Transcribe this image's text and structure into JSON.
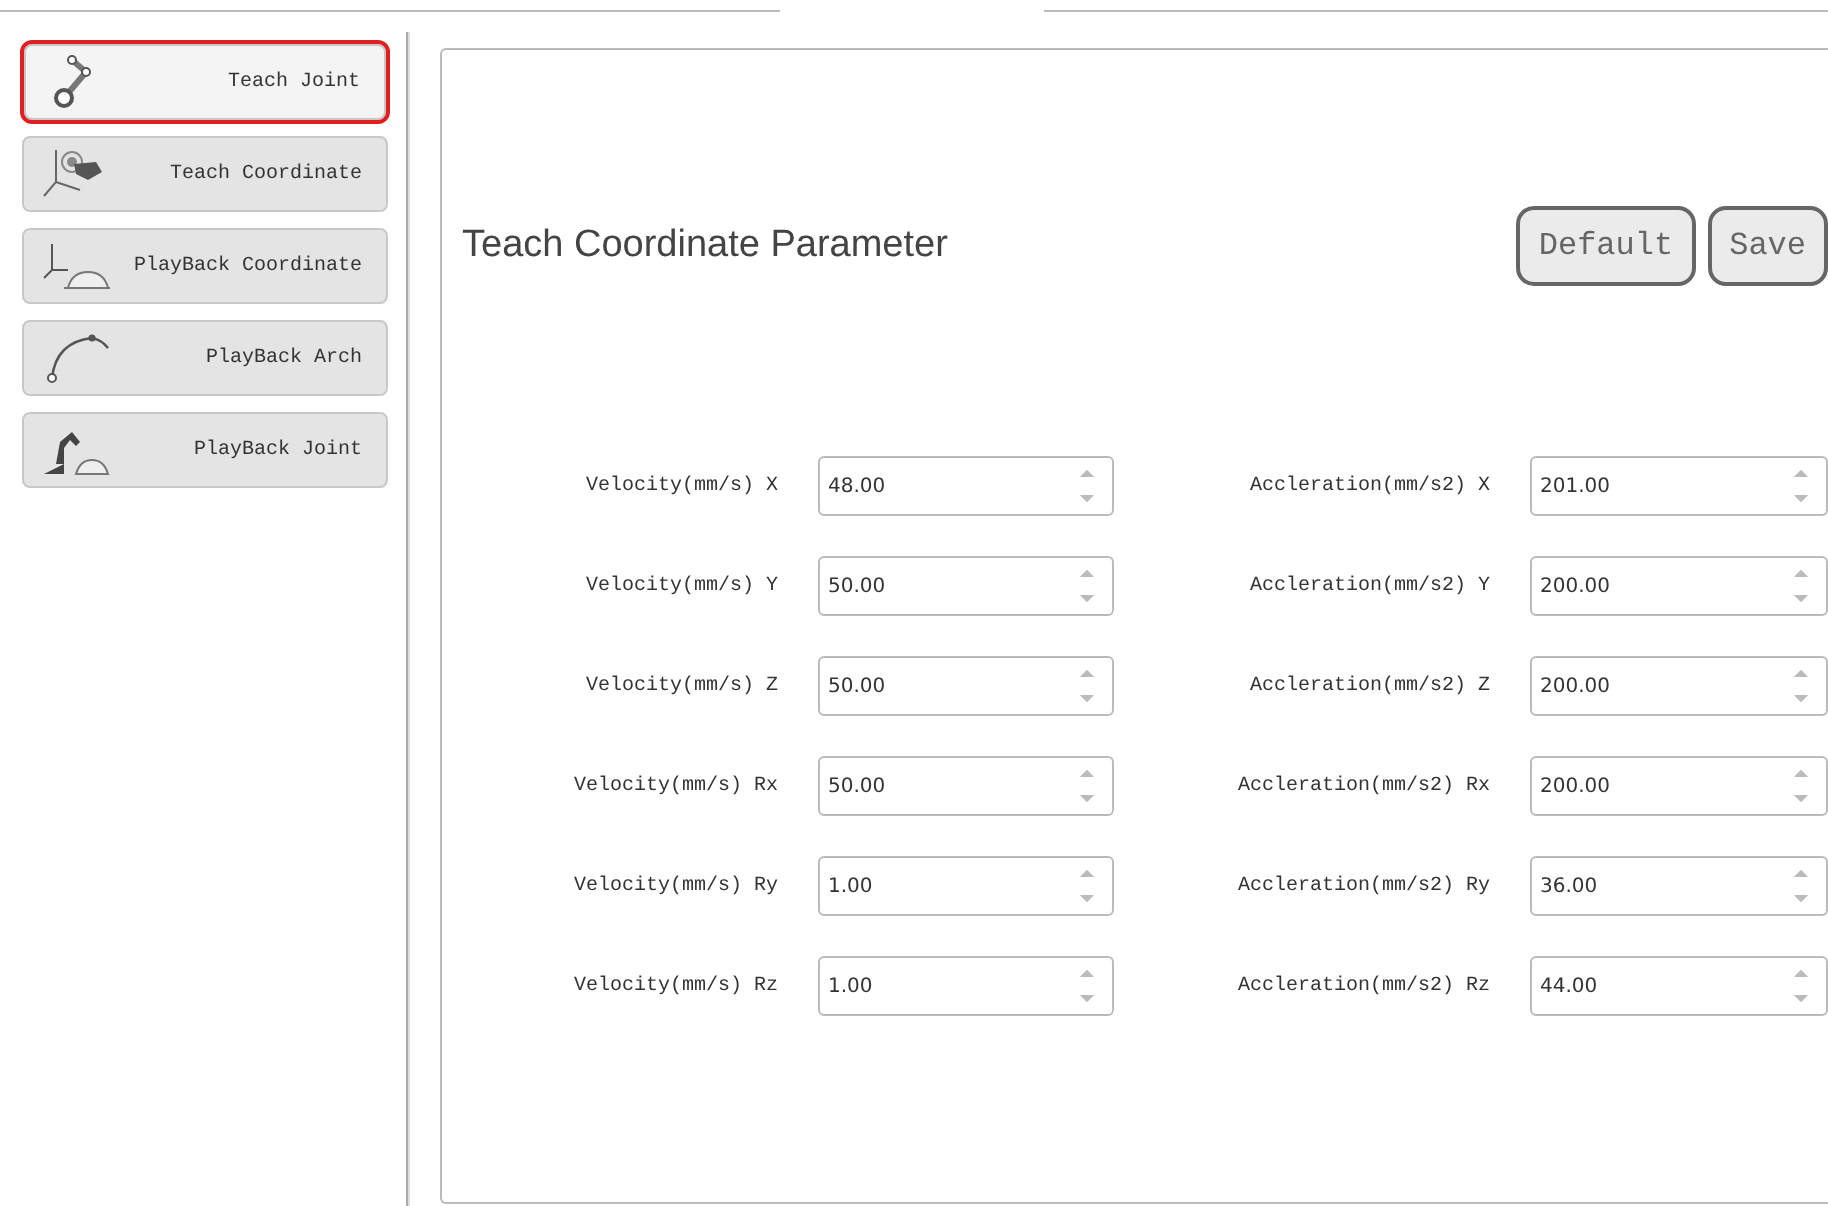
{
  "sidebar": {
    "items": [
      {
        "label": "Teach Joint",
        "selected": true
      },
      {
        "label": "Teach Coordinate",
        "selected": false
      },
      {
        "label": "PlayBack Coordinate",
        "selected": false
      },
      {
        "label": "PlayBack Arch",
        "selected": false
      },
      {
        "label": "PlayBack Joint",
        "selected": false
      }
    ]
  },
  "panel": {
    "title": "Teach Coordinate Parameter",
    "buttons": [
      "Default",
      "Save"
    ],
    "rows": [
      {
        "velocity": {
          "label": "Velocity(mm/s) X",
          "value": "48.00"
        },
        "acceleration": {
          "label": "Accleration(mm/s2) X",
          "value": "201.00"
        }
      },
      {
        "velocity": {
          "label": "Velocity(mm/s) Y",
          "value": "50.00"
        },
        "acceleration": {
          "label": "Accleration(mm/s2) Y",
          "value": "200.00"
        }
      },
      {
        "velocity": {
          "label": "Velocity(mm/s) Z",
          "value": "50.00"
        },
        "acceleration": {
          "label": "Accleration(mm/s2) Z",
          "value": "200.00"
        }
      },
      {
        "velocity": {
          "label": "Velocity(mm/s) Rx",
          "value": "50.00"
        },
        "acceleration": {
          "label": "Accleration(mm/s2) Rx",
          "value": "200.00"
        }
      },
      {
        "velocity": {
          "label": "Velocity(mm/s) Ry",
          "value": "1.00"
        },
        "acceleration": {
          "label": "Accleration(mm/s2) Ry",
          "value": "36.00"
        }
      },
      {
        "velocity": {
          "label": "Velocity(mm/s) Rz",
          "value": "1.00"
        },
        "acceleration": {
          "label": "Accleration(mm/s2) Rz",
          "value": "44.00"
        }
      }
    ]
  }
}
